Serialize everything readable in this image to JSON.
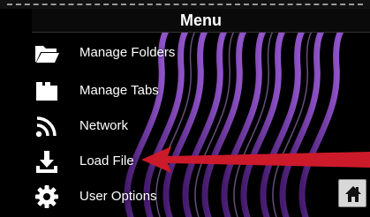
{
  "menu": {
    "title": "Menu",
    "items": [
      {
        "label": "Manage Folders",
        "icon": "folder-icon"
      },
      {
        "label": "Manage Tabs",
        "icon": "tabs-icon"
      },
      {
        "label": "Network",
        "icon": "wifi-icon"
      },
      {
        "label": "Load File",
        "icon": "download-icon"
      },
      {
        "label": "User Options",
        "icon": "gear-icon"
      }
    ]
  },
  "home_button": {
    "icon": "home-icon"
  },
  "annotation": {
    "icon": "arrow-icon",
    "color": "#cc1a2a"
  },
  "colors": {
    "background": "#000000",
    "swirl": "#7a3bb4",
    "text": "#ffffff",
    "home_button_bg": "#d8d8d8"
  }
}
